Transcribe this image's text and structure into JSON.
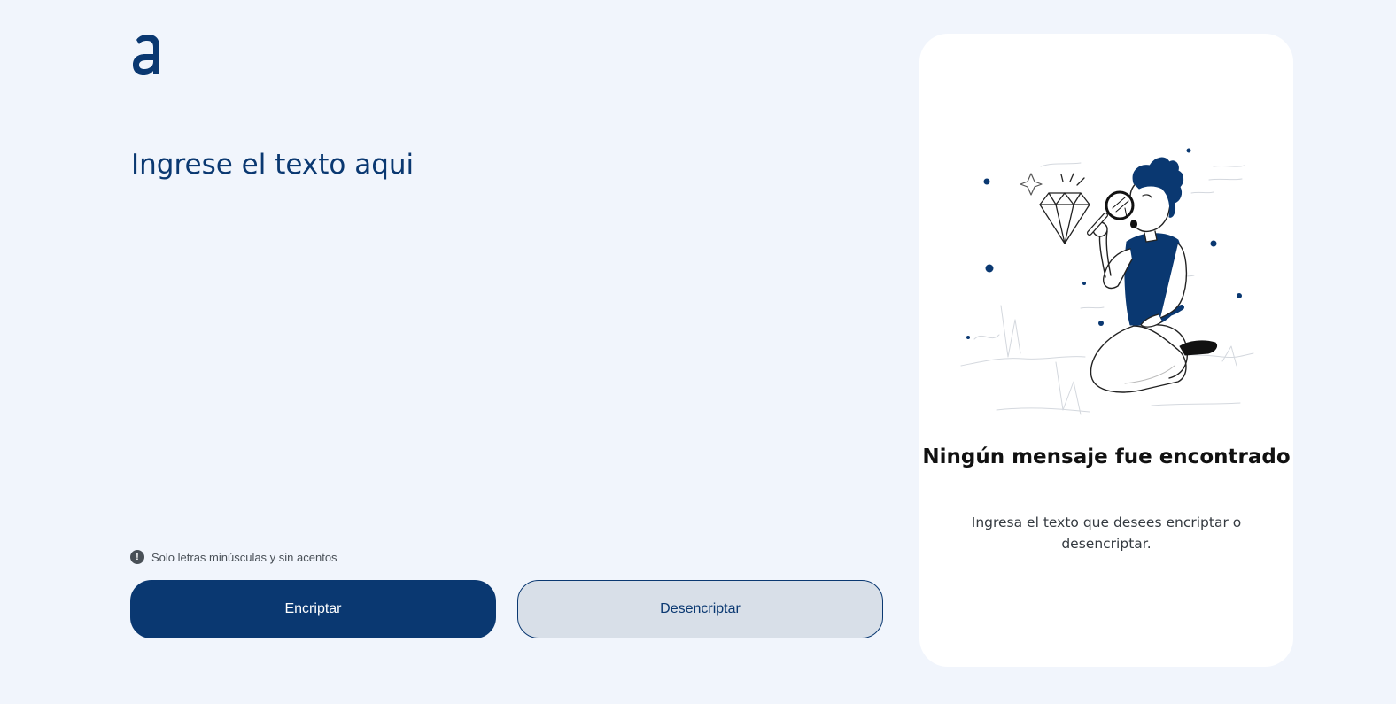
{
  "app": {
    "logo_icon": "alura-a-logo-icon"
  },
  "editor": {
    "placeholder": "Ingrese el texto aqui",
    "value": ""
  },
  "hint": {
    "icon": "exclamation-circle-icon",
    "text": "Solo letras minúsculas y sin acentos"
  },
  "actions": {
    "encrypt_label": "Encriptar",
    "decrypt_label": "Desencriptar"
  },
  "output": {
    "illustration": "person-with-magnifying-glass-and-diamond-illustration",
    "title": "Ningún mensaje fue encontrado",
    "description": "Ingresa el texto que desees encriptar o desencriptar."
  },
  "colors": {
    "background": "#f1f5fc",
    "primary": "#0a3871",
    "secondary_fill": "#d8dfe8",
    "panel": "#ffffff",
    "hint_text": "#495057"
  }
}
